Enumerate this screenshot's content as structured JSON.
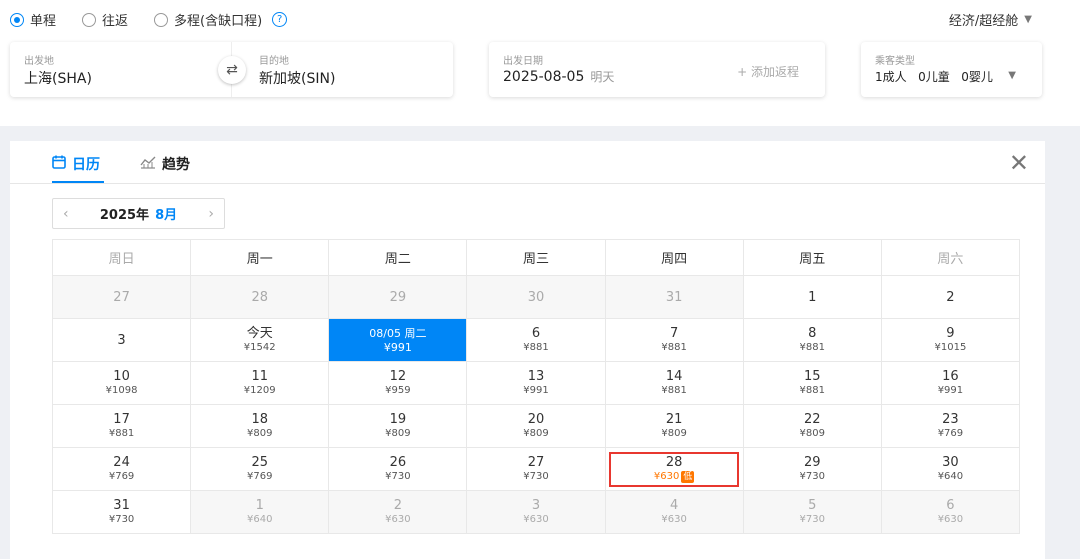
{
  "trip_types": [
    {
      "label": "单程",
      "selected": true
    },
    {
      "label": "往返",
      "selected": false
    },
    {
      "label": "多程(含缺口程)",
      "selected": false
    }
  ],
  "help_icon": "?",
  "cabin": "经济/超经舱",
  "origin": {
    "label": "出发地",
    "value": "上海(SHA)"
  },
  "destination": {
    "label": "目的地",
    "value": "新加坡(SIN)"
  },
  "depart": {
    "label": "出发日期",
    "value": "2025-08-05",
    "hint": "明天"
  },
  "add_return": "+ 添加返程",
  "passengers": {
    "label": "乘客类型",
    "adults": "1成人",
    "children": "0儿童",
    "infants": "0婴儿"
  },
  "tabs": [
    {
      "label": "日历",
      "icon": "calendar-icon",
      "active": true
    },
    {
      "label": "趋势",
      "icon": "trend-chart-icon",
      "active": false
    }
  ],
  "close_icon": "✕",
  "month_nav": {
    "year": "2025年",
    "month": "8月"
  },
  "weekdays": [
    "周日",
    "周一",
    "周二",
    "周三",
    "周四",
    "周五",
    "周六"
  ],
  "weeks": [
    [
      {
        "d": "27",
        "p": "",
        "s": "past"
      },
      {
        "d": "28",
        "p": "",
        "s": "past"
      },
      {
        "d": "29",
        "p": "",
        "s": "past"
      },
      {
        "d": "30",
        "p": "",
        "s": "past"
      },
      {
        "d": "31",
        "p": "",
        "s": "past"
      },
      {
        "d": "1",
        "p": "",
        "s": ""
      },
      {
        "d": "2",
        "p": "",
        "s": ""
      }
    ],
    [
      {
        "d": "3",
        "p": "",
        "s": ""
      },
      {
        "d": "今天",
        "p": "¥1542",
        "s": ""
      },
      {
        "d": "08/05 周二",
        "p": "¥991",
        "s": "selected"
      },
      {
        "d": "6",
        "p": "¥881",
        "s": ""
      },
      {
        "d": "7",
        "p": "¥881",
        "s": ""
      },
      {
        "d": "8",
        "p": "¥881",
        "s": ""
      },
      {
        "d": "9",
        "p": "¥1015",
        "s": ""
      }
    ],
    [
      {
        "d": "10",
        "p": "¥1098",
        "s": ""
      },
      {
        "d": "11",
        "p": "¥1209",
        "s": ""
      },
      {
        "d": "12",
        "p": "¥959",
        "s": ""
      },
      {
        "d": "13",
        "p": "¥991",
        "s": ""
      },
      {
        "d": "14",
        "p": "¥881",
        "s": ""
      },
      {
        "d": "15",
        "p": "¥881",
        "s": ""
      },
      {
        "d": "16",
        "p": "¥991",
        "s": ""
      }
    ],
    [
      {
        "d": "17",
        "p": "¥881",
        "s": ""
      },
      {
        "d": "18",
        "p": "¥809",
        "s": ""
      },
      {
        "d": "19",
        "p": "¥809",
        "s": ""
      },
      {
        "d": "20",
        "p": "¥809",
        "s": ""
      },
      {
        "d": "21",
        "p": "¥809",
        "s": ""
      },
      {
        "d": "22",
        "p": "¥809",
        "s": ""
      },
      {
        "d": "23",
        "p": "¥769",
        "s": ""
      }
    ],
    [
      {
        "d": "24",
        "p": "¥769",
        "s": ""
      },
      {
        "d": "25",
        "p": "¥769",
        "s": ""
      },
      {
        "d": "26",
        "p": "¥730",
        "s": ""
      },
      {
        "d": "27",
        "p": "¥730",
        "s": ""
      },
      {
        "d": "28",
        "p": "¥630",
        "s": "lowest",
        "badge": "低"
      },
      {
        "d": "29",
        "p": "¥730",
        "s": ""
      },
      {
        "d": "30",
        "p": "¥640",
        "s": ""
      }
    ],
    [
      {
        "d": "31",
        "p": "¥730",
        "s": ""
      },
      {
        "d": "1",
        "p": "¥640",
        "s": "next"
      },
      {
        "d": "2",
        "p": "¥630",
        "s": "next"
      },
      {
        "d": "3",
        "p": "¥630",
        "s": "next"
      },
      {
        "d": "4",
        "p": "¥630",
        "s": "next"
      },
      {
        "d": "5",
        "p": "¥730",
        "s": "next"
      },
      {
        "d": "6",
        "p": "¥630",
        "s": "next"
      }
    ]
  ],
  "colors": {
    "accent": "#0086f6",
    "lowest_border": "#e8372f",
    "lowest_price": "#ff7700"
  }
}
